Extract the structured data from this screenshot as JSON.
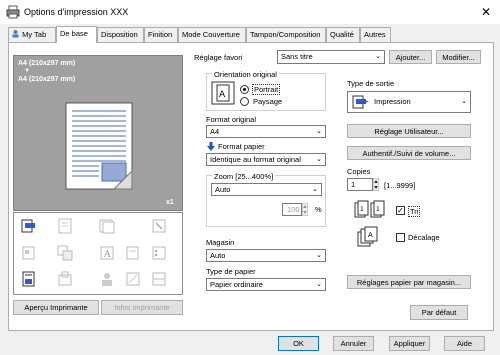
{
  "window": {
    "title": "Options d'impression XXX",
    "close": "✕"
  },
  "tabs": [
    {
      "label": "My Tab"
    },
    {
      "label": "De base"
    },
    {
      "label": "Disposition"
    },
    {
      "label": "Finition"
    },
    {
      "label": "Mode Couverture"
    },
    {
      "label": "Tampon/Composition"
    },
    {
      "label": "Qualité"
    },
    {
      "label": "Autres"
    }
  ],
  "preview": {
    "top_text1": "A4 (210x297 mm)",
    "arrow": "▼",
    "top_text2": "A4 (210x297 mm)",
    "count": "x1"
  },
  "left_buttons": {
    "apercu": "Aperçu Imprimante",
    "infos": "Infos imprimante"
  },
  "favorite": {
    "label": "Réglage favori",
    "value": "Sans titre",
    "add": "Ajouter...",
    "modify": "Modifier..."
  },
  "orientation": {
    "label": "Orientation original",
    "portrait": "Portrait",
    "paysage": "Paysage",
    "selected": "Portrait"
  },
  "format_original": {
    "label": "Format original",
    "value": "A4"
  },
  "format_papier": {
    "label": "Format papier",
    "value": "Identique au format original"
  },
  "zoom": {
    "label": "Zoom [25...400%]",
    "value": "Auto",
    "number": "100",
    "unit": "%"
  },
  "magasin": {
    "label": "Magasin",
    "value": "Auto"
  },
  "type_papier": {
    "label": "Type de papier",
    "value": "Papier ordinaire"
  },
  "sortie": {
    "label": "Type de sortie",
    "value": "Impression"
  },
  "reglage_utilisateur": "Réglage Utilisateur...",
  "authentif": "Authentif./Suivi de volume...",
  "copies": {
    "label": "Copies",
    "value": "1",
    "range": "[1...9999]"
  },
  "tri": {
    "label": "Tri",
    "checked": true
  },
  "decalage": {
    "label": "Décalage",
    "checked": false
  },
  "reglages_papier": "Réglages papier par magasin...",
  "par_defaut": "Par défaut",
  "footer": {
    "ok": "OK",
    "annuler": "Annuler",
    "appliquer": "Appliquer",
    "aide": "Aide"
  },
  "colors": {
    "accent": "#0078d7",
    "panel_bg": "#f0f0f0",
    "preview_bg": "#a0a0a0"
  }
}
